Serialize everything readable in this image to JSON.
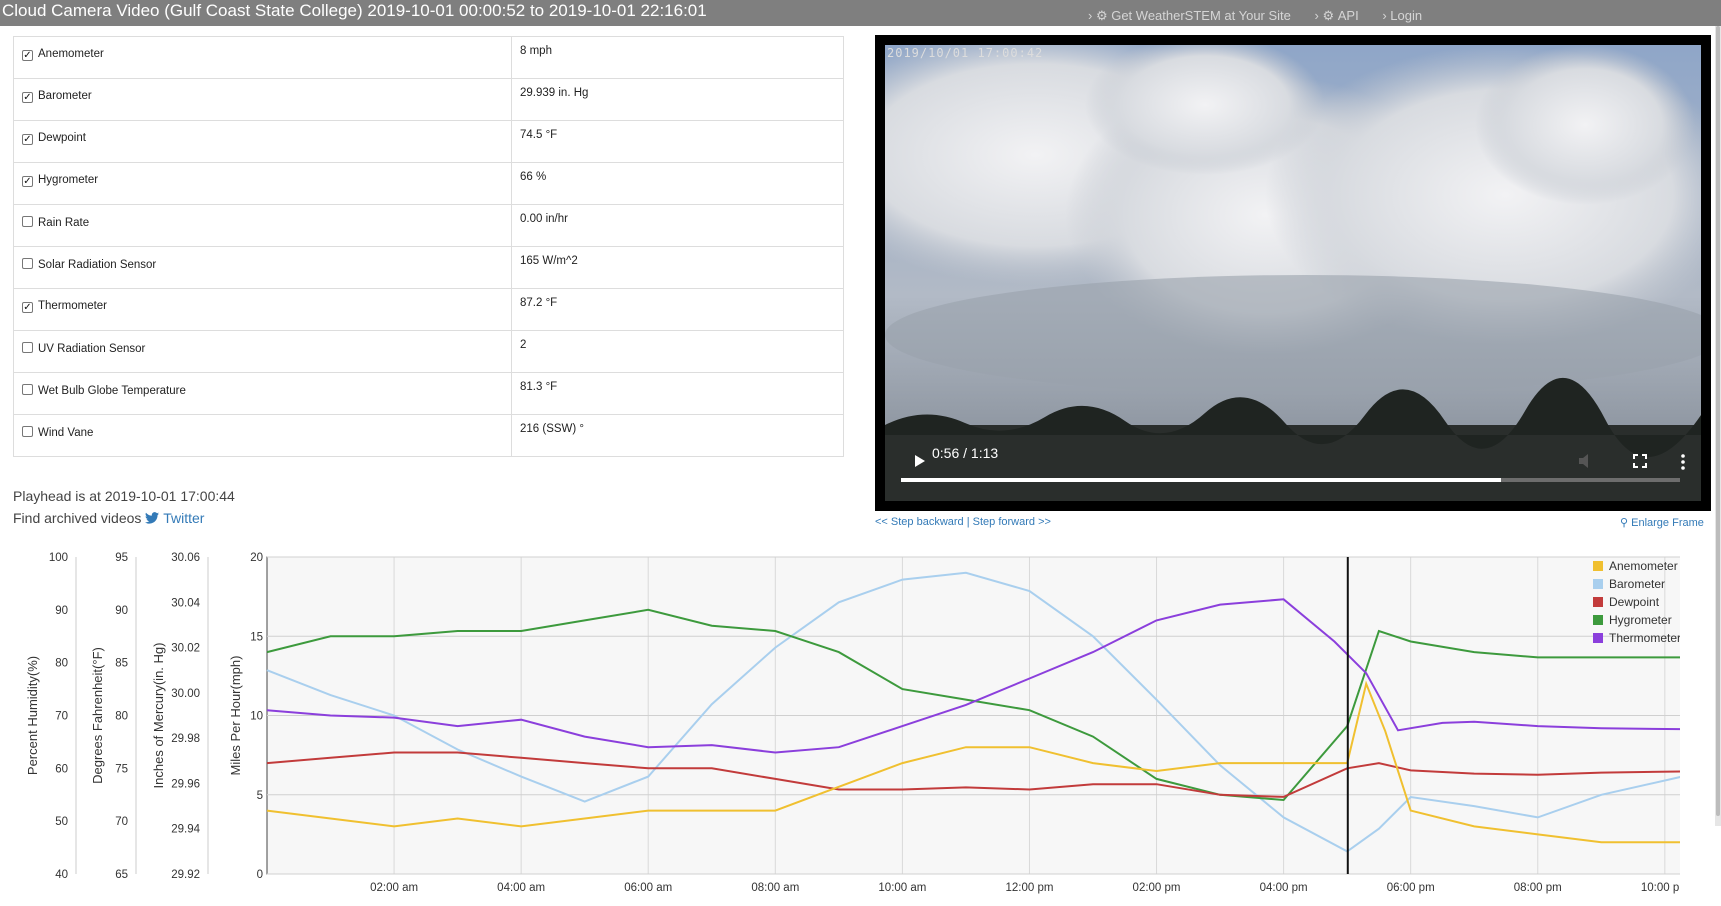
{
  "window_title": "Cloud Camera Video (Gulf Coast State College) 2019-10-01 00:00:52 to 2019-10-01 22:16:01",
  "topnav": [
    "Get WeatherSTEM at Your Site",
    "API",
    "Login"
  ],
  "sensors": [
    {
      "name": "Anemometer",
      "value": "8 mph",
      "checked": true
    },
    {
      "name": "Barometer",
      "value": "29.939 in. Hg",
      "checked": true
    },
    {
      "name": "Dewpoint",
      "value": "74.5 °F",
      "checked": true
    },
    {
      "name": "Hygrometer",
      "value": "66 %",
      "checked": true
    },
    {
      "name": "Rain Rate",
      "value": "0.00 in/hr",
      "checked": false
    },
    {
      "name": "Solar Radiation Sensor",
      "value": "165 W/m^2",
      "checked": false
    },
    {
      "name": "Thermometer",
      "value": "87.2 °F",
      "checked": true
    },
    {
      "name": "UV Radiation Sensor",
      "value": "2",
      "checked": false
    },
    {
      "name": "Wet Bulb Globe Temperature",
      "value": "81.3 °F",
      "checked": false
    },
    {
      "name": "Wind Vane",
      "value": "216 (SSW) °",
      "checked": false
    }
  ],
  "playhead_text": "Playhead is at 2019-10-01 17:00:44",
  "archive_text": "Find archived videos",
  "archive_link": "Twitter",
  "video": {
    "timestamp": "2019/10/01 17:00:42",
    "time_display": "0:56 / 1:13",
    "progress": 0.77
  },
  "step_backward": "<< Step backward",
  "step_forward": "Step forward >>",
  "step_separator": "|",
  "enlarge": "Enlarge Frame",
  "colors": {
    "anemometer": "#f0c030",
    "barometer": "#a9cfee",
    "dewpoint": "#c23b3b",
    "hygrometer": "#3d9a3d",
    "thermometer": "#8b3fdc",
    "link": "#337ab7"
  },
  "chart_data": {
    "type": "line",
    "x_ticks": [
      "02:00 am",
      "04:00 am",
      "06:00 am",
      "08:00 am",
      "10:00 am",
      "12:00 pm",
      "02:00 pm",
      "04:00 pm",
      "06:00 pm",
      "08:00 pm",
      "10:00 pm"
    ],
    "x_range_hours": [
      0.0,
      22.27
    ],
    "playhead_hour": 17.01,
    "axes": [
      {
        "label": "Percent Humidity(%)",
        "ticks": [
          "100",
          "90",
          "80",
          "70",
          "60",
          "50",
          "40"
        ],
        "range": [
          40,
          100
        ]
      },
      {
        "label": "Degrees Fahrenheit(°F)",
        "ticks": [
          "95",
          "90",
          "85",
          "80",
          "75",
          "70",
          "65"
        ],
        "range": [
          65,
          95
        ]
      },
      {
        "label": "Inches of Mercury(in. Hg)",
        "ticks": [
          "30.06",
          "30.04",
          "30.02",
          "30.00",
          "29.98",
          "29.96",
          "29.94",
          "29.92"
        ],
        "range": [
          29.92,
          30.06
        ]
      },
      {
        "label": "Miles Per Hour(mph)",
        "ticks": [
          "20",
          "15",
          "10",
          "5",
          "0"
        ],
        "range": [
          0,
          20
        ]
      }
    ],
    "legend": [
      "Anemometer",
      "Barometer",
      "Dewpoint",
      "Hygrometer",
      "Thermometer"
    ],
    "legend_position": "top-right",
    "grid": true,
    "series": [
      {
        "name": "Barometer",
        "axis": "inHg",
        "x": [
          0,
          1,
          2,
          3,
          4,
          5,
          6,
          7,
          8,
          9,
          10,
          11,
          12,
          13,
          14,
          15,
          16,
          17,
          17.5,
          18,
          19,
          20,
          21,
          22.27
        ],
        "y": [
          30.01,
          29.999,
          29.99,
          29.975,
          29.963,
          29.952,
          29.963,
          29.995,
          30.02,
          30.04,
          30.05,
          30.053,
          30.045,
          30.025,
          29.997,
          29.968,
          29.945,
          29.93,
          29.94,
          29.954,
          29.95,
          29.945,
          29.955,
          29.963
        ]
      },
      {
        "name": "Hygrometer",
        "axis": "humidity",
        "x": [
          0,
          1,
          2,
          3,
          4,
          5,
          6,
          7,
          8,
          9,
          10,
          11,
          12,
          13,
          14,
          15,
          16,
          17,
          17.5,
          18,
          19,
          20,
          21,
          22.27
        ],
        "y": [
          82,
          85,
          85,
          86,
          86,
          88,
          90,
          87,
          86,
          82,
          75,
          73,
          71,
          66,
          58,
          55,
          54,
          68,
          86,
          84,
          82,
          81,
          81,
          81
        ]
      },
      {
        "name": "Dewpoint",
        "axis": "temp",
        "x": [
          0,
          1,
          2,
          3,
          4,
          5,
          6,
          7,
          8,
          9,
          10,
          11,
          12,
          13,
          14,
          15,
          16,
          17,
          17.5,
          18,
          19,
          20,
          21,
          22.27
        ],
        "y": [
          75.5,
          76,
          76.5,
          76.5,
          76,
          75.5,
          75,
          75,
          74,
          73,
          73,
          73.2,
          73,
          73.5,
          73.5,
          72.5,
          72.3,
          75,
          75.5,
          74.8,
          74.5,
          74.4,
          74.6,
          74.7
        ]
      },
      {
        "name": "Thermometer",
        "axis": "temp",
        "x": [
          0,
          1,
          2,
          3,
          4,
          5,
          6,
          7,
          8,
          9,
          10,
          11,
          12,
          13,
          14,
          15,
          16,
          16.8,
          17.3,
          17.8,
          18.5,
          19,
          20,
          21,
          22.27
        ],
        "y": [
          80.5,
          80,
          79.8,
          79,
          79.6,
          78,
          77,
          77.2,
          76.5,
          77,
          79,
          81,
          83.5,
          86,
          89,
          90.5,
          91,
          87,
          84,
          78.6,
          79.3,
          79.4,
          79,
          78.8,
          78.7
        ]
      },
      {
        "name": "Anemometer",
        "axis": "mph",
        "x": [
          0,
          1,
          2,
          3,
          4,
          5,
          6,
          7,
          8,
          9,
          10,
          11,
          12,
          13,
          14,
          15,
          16,
          17,
          17.3,
          17.6,
          18,
          19,
          20,
          21,
          22.27
        ],
        "y": [
          4,
          3.5,
          3,
          3.5,
          3,
          3.5,
          4,
          4,
          4,
          5.5,
          7,
          8,
          8,
          7,
          6.5,
          7,
          7,
          7,
          12,
          9,
          4,
          3,
          2.5,
          2,
          2
        ]
      }
    ]
  }
}
